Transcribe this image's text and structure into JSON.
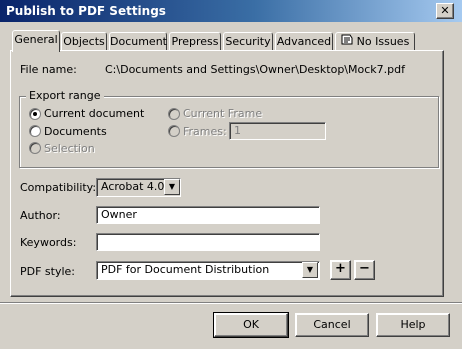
{
  "window": {
    "title": "Publish to PDF Settings",
    "close_glyph": "✕"
  },
  "tabs": [
    {
      "label": "General",
      "active": true
    },
    {
      "label": "Objects"
    },
    {
      "label": "Document"
    },
    {
      "label": "Prepress"
    },
    {
      "label": "Security"
    },
    {
      "label": "Advanced"
    },
    {
      "label": "No Issues",
      "icon": "issues-icon"
    }
  ],
  "file": {
    "label": "File name:",
    "value": "C:\\Documents and Settings\\Owner\\Desktop\\Mock7.pdf"
  },
  "export_range": {
    "legend": "Export range",
    "options": [
      {
        "label": "Current document",
        "selected": true,
        "enabled": true
      },
      {
        "label": "Documents",
        "selected": false,
        "enabled": true
      },
      {
        "label": "Selection",
        "selected": false,
        "enabled": false
      },
      {
        "label": "Current Frame",
        "selected": false,
        "enabled": false
      },
      {
        "label": "Frames:",
        "selected": false,
        "enabled": false
      }
    ],
    "frames_value": "1"
  },
  "compatibility": {
    "label": "Compatibility:",
    "value": "Acrobat 4.0"
  },
  "author": {
    "label": "Author:",
    "value": "Owner"
  },
  "keywords": {
    "label": "Keywords:",
    "value": ""
  },
  "pdf_style": {
    "label": "PDF style:",
    "value": "PDF for Document Distribution",
    "add_glyph": "+",
    "remove_glyph": "−"
  },
  "buttons": {
    "ok": "OK",
    "cancel": "Cancel",
    "help": "Help"
  },
  "colors": {
    "title_start": "#0a246a",
    "title_end": "#a6caf0",
    "face": "#d4d0c8"
  }
}
